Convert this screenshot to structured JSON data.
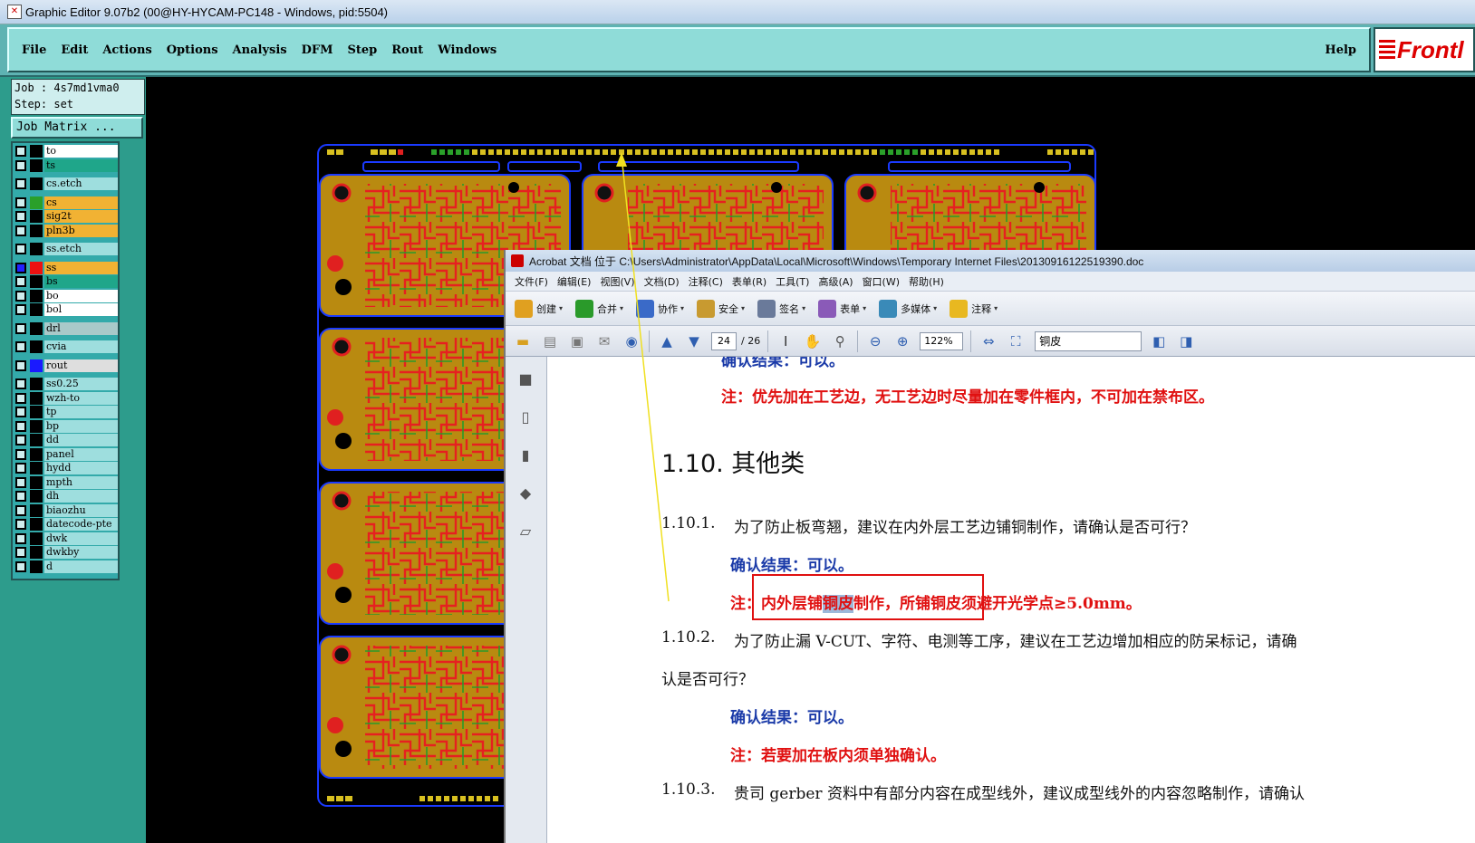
{
  "editor": {
    "title": "Graphic Editor 9.07b2 (00@HY-HYCAM-PC148 - Windows, pid:5504)",
    "menu": [
      "File",
      "Edit",
      "Actions",
      "Options",
      "Analysis",
      "DFM",
      "Step",
      "Rout",
      "Windows"
    ],
    "help": "Help",
    "logo": "Frontl",
    "job_line": "Job : 4s7md1vma0",
    "step_line": "Step: set",
    "job_matrix": "Job Matrix ...",
    "layers": [
      {
        "name": "to",
        "bg": "#ffffff",
        "swatch": "#000000"
      },
      {
        "name": "ts",
        "bg": "#1fa68a",
        "swatch": "#000000"
      },
      {
        "name": "cs.etch",
        "bg": "#9edede",
        "swatch": "#000000"
      },
      {
        "name": "cs",
        "bg": "#f1b233",
        "swatch": "#2aa02a"
      },
      {
        "name": "sig2t",
        "bg": "#f1b233",
        "swatch": "#000000"
      },
      {
        "name": "pln3b",
        "bg": "#f1b233",
        "swatch": "#000000"
      },
      {
        "name": "ss.etch",
        "bg": "#9edede",
        "swatch": "#000000"
      },
      {
        "name": "ss",
        "bg": "#f1b233",
        "swatch": "#ee1111",
        "checked": true
      },
      {
        "name": "bs",
        "bg": "#1fa68a",
        "swatch": "#000000"
      },
      {
        "name": "bo",
        "bg": "#ffffff",
        "swatch": "#000000"
      },
      {
        "name": "bol",
        "bg": "#ffffff",
        "swatch": "#000000"
      },
      {
        "name": "drl",
        "bg": "#a9c9c9",
        "swatch": "#000000"
      },
      {
        "name": "cvia",
        "bg": "#9edede",
        "swatch": "#000000"
      },
      {
        "name": "rout",
        "bg": "#dedede",
        "swatch": "#1a1aff"
      },
      {
        "name": "ss0.25",
        "bg": "#9edede",
        "swatch": "#000000"
      },
      {
        "name": "wzh-to",
        "bg": "#9edede",
        "swatch": "#000000"
      },
      {
        "name": "tp",
        "bg": "#9edede",
        "swatch": "#000000"
      },
      {
        "name": "bp",
        "bg": "#9edede",
        "swatch": "#000000"
      },
      {
        "name": "dd",
        "bg": "#9edede",
        "swatch": "#000000"
      },
      {
        "name": "panel",
        "bg": "#9edede",
        "swatch": "#000000"
      },
      {
        "name": "hydd",
        "bg": "#9edede",
        "swatch": "#000000"
      },
      {
        "name": "mpth",
        "bg": "#9edede",
        "swatch": "#000000"
      },
      {
        "name": "dh",
        "bg": "#9edede",
        "swatch": "#000000"
      },
      {
        "name": "biaozhu",
        "bg": "#9edede",
        "swatch": "#000000"
      },
      {
        "name": "datecode-pte",
        "bg": "#9edede",
        "swatch": "#000000"
      },
      {
        "name": "dwk",
        "bg": "#9edede",
        "swatch": "#000000"
      },
      {
        "name": "dwkby",
        "bg": "#9edede",
        "swatch": "#000000"
      },
      {
        "name": "d",
        "bg": "#9edede",
        "swatch": "#000000"
      }
    ]
  },
  "acrobat": {
    "title": "Acrobat 文档 位于 C:\\Users\\Administrator\\AppData\\Local\\Microsoft\\Windows\\Temporary Internet Files\\20130916122519390.doc",
    "menu": [
      "文件(F)",
      "编辑(E)",
      "视图(V)",
      "文档(D)",
      "注释(C)",
      "表单(R)",
      "工具(T)",
      "高级(A)",
      "窗口(W)",
      "帮助(H)"
    ],
    "toolbar1": [
      {
        "label": "创建",
        "icon": "create-icon",
        "color": "#e0a020"
      },
      {
        "label": "合并",
        "icon": "combine-icon",
        "color": "#2a9a2a"
      },
      {
        "label": "协作",
        "icon": "collaborate-icon",
        "color": "#3a6ac8"
      },
      {
        "label": "安全",
        "icon": "lock-icon",
        "color": "#c89a30"
      },
      {
        "label": "签名",
        "icon": "pen-icon",
        "color": "#6a7a9a"
      },
      {
        "label": "表单",
        "icon": "form-icon",
        "color": "#8a5ab8"
      },
      {
        "label": "多媒体",
        "icon": "multimedia-icon",
        "color": "#3a8ab8"
      },
      {
        "label": "注释",
        "icon": "comment-icon",
        "color": "#e8b820"
      }
    ],
    "page_current": "24",
    "page_total": "/ 26",
    "zoom": "122%",
    "find_text": "铜皮"
  },
  "document": {
    "line_top_partial": "确认结果：可以。",
    "note1": "注：优先加在工艺边，无工艺边时尽量加在零件框内，不可加在禁布区。",
    "heading": "1.10.  其他类",
    "q1_num": "1.10.1.",
    "q1_text": "为了防止板弯翘，建议在内外层工艺边铺铜制作，请确认是否可行？",
    "confirm": "确认结果：可以。",
    "note2_a": "注：内外层铺",
    "note2_hl": "铜皮",
    "note2_b": "制作，",
    "note2_c": "所铺铜皮须避开光学点≥5.0mm。",
    "q2_num": "1.10.2.",
    "q2_text": "为了防止漏 V-CUT、字符、电测等工序，建议在工艺边增加相应的防呆标记，请确",
    "q2_text2": "认是否可行？",
    "confirm2": "确认结果：可以。",
    "note3": "注：若要加在板内须单独确认。",
    "q3_num": "1.10.3.",
    "q3_text": "贵司 gerber 资料中有部分内容在成型线外，建议成型线外的内容忽略制作，请确认"
  }
}
